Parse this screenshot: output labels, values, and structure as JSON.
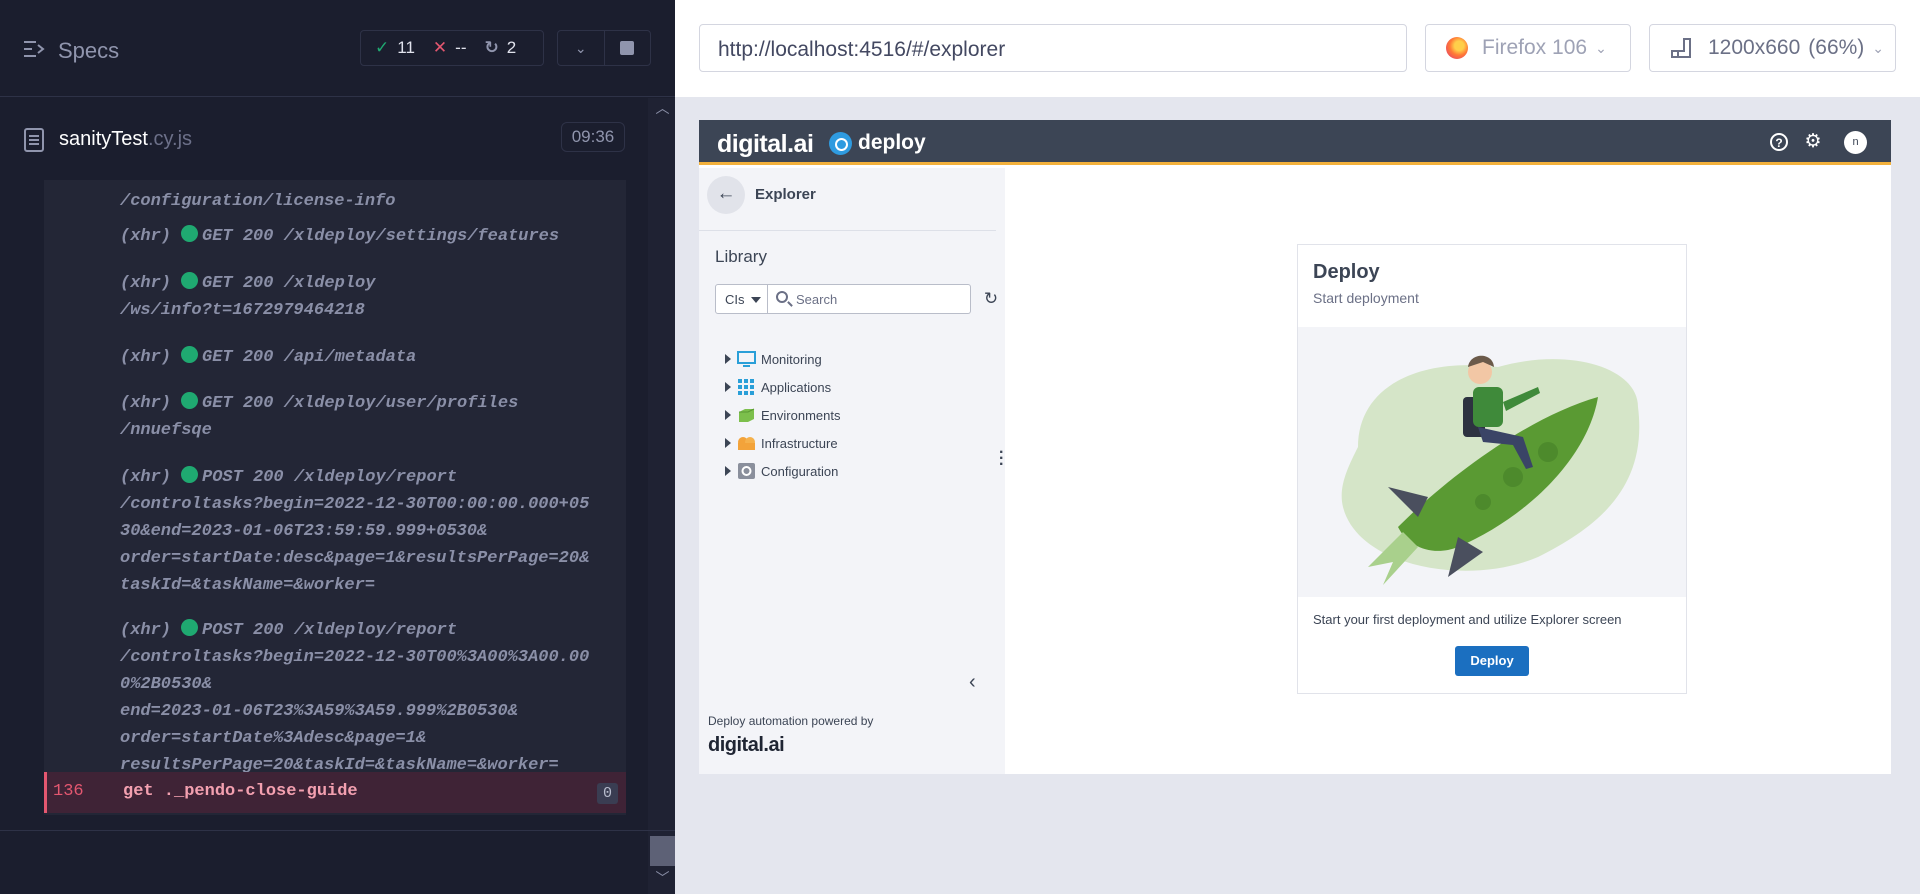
{
  "runner": {
    "title": "Specs",
    "stats": {
      "passed": "11",
      "failed": "--",
      "pending": "2"
    },
    "spec": {
      "name": "sanityTest",
      "ext": ".cy.js",
      "duration": "09:36"
    },
    "log_lines": [
      "/configuration/license-info",
      "(xhr)",
      "GET 200 /xldeploy/settings/features",
      "(xhr)",
      "GET 200 /xldeploy",
      "/ws/info?t=1672979464218",
      "(xhr)",
      "GET 200 /api/metadata",
      "(xhr)",
      "GET 200 /xldeploy/user/profiles",
      "/nnuefsqe",
      "(xhr)",
      "POST 200 /xldeploy/report",
      "/controltasks?begin=2022-12-30T00:00:00.000+05",
      "30&end=2023-01-06T23:59:59.999+0530&",
      "order=startDate:desc&page=1&resultsPerPage=20&",
      "taskId=&taskName=&worker=",
      "(xhr)",
      "POST 200 /xldeploy/report",
      "/controltasks?begin=2022-12-30T00%3A00%3A00.00",
      "0%2B0530&",
      "end=2023-01-06T23%3A59%3A59.999%2B0530&",
      "order=startDate%3Adesc&page=1&",
      "resultsPerPage=20&taskId=&taskName=&worker="
    ],
    "command": {
      "number": "136",
      "name": "get  ._pendo-close-guide",
      "badge": "0"
    }
  },
  "aut": {
    "url": "http://localhost:4516/#/explorer",
    "browser": "Firefox 106",
    "viewport": "1200x660",
    "zoom": "(66%)"
  },
  "app": {
    "logo": "digital.ai",
    "product": "deploy",
    "avatar_initial": "n",
    "nav_title": "Explorer",
    "library_title": "Library",
    "filter_select": "CIs",
    "search_placeholder": "Search",
    "tree": [
      {
        "label": "Monitoring",
        "icon": "monitor-icon"
      },
      {
        "label": "Applications",
        "icon": "applications-grid-icon"
      },
      {
        "label": "Environments",
        "icon": "environments-icon"
      },
      {
        "label": "Infrastructure",
        "icon": "infrastructure-icon"
      },
      {
        "label": "Configuration",
        "icon": "configuration-gear-icon"
      }
    ],
    "powered_by": "Deploy automation powered by",
    "powered_logo": "digital.ai",
    "card": {
      "title": "Deploy",
      "subtitle": "Start deployment",
      "text": "Start your first deployment and utilize Explorer screen",
      "button": "Deploy"
    }
  },
  "colors": {
    "pass": "#1fa971",
    "fail": "#e45770",
    "app_header": "#3c4555",
    "header_accent": "#f3b13c",
    "primary_button": "#1b6fc0"
  }
}
